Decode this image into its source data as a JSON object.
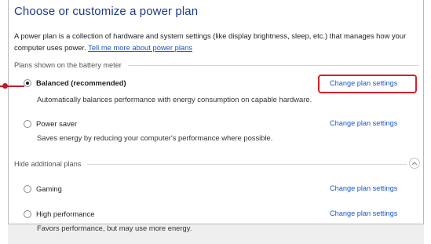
{
  "page": {
    "title": "Choose or customize a power plan",
    "description": "A power plan is a collection of hardware and system settings (like display brightness, sleep, etc.) that manages how your computer uses power.",
    "learn_more_link": "Tell me more about power plans"
  },
  "battery_meter_group": {
    "label": "Plans shown on the battery meter",
    "plans": [
      {
        "name": "Balanced (recommended)",
        "selected": true,
        "description": "Automatically balances performance with energy consumption on capable hardware.",
        "change_link": "Change plan settings"
      },
      {
        "name": "Power saver",
        "selected": false,
        "description": "Saves energy by reducing your computer's performance where possible.",
        "change_link": "Change plan settings"
      }
    ]
  },
  "additional_group": {
    "label": "Hide additional plans",
    "plans": [
      {
        "name": "Gaming",
        "selected": false,
        "description": "",
        "change_link": "Change plan settings"
      },
      {
        "name": "High performance",
        "selected": false,
        "description": "Favors performance, but may use more energy.",
        "change_link": "Change plan settings"
      }
    ]
  },
  "icons": {
    "collapse": "chevron-up-icon",
    "radio": "radio-button-icon"
  },
  "colors": {
    "heading": "#1e3a8a",
    "link": "#1a56c8",
    "highlight": "#d41f2d"
  }
}
